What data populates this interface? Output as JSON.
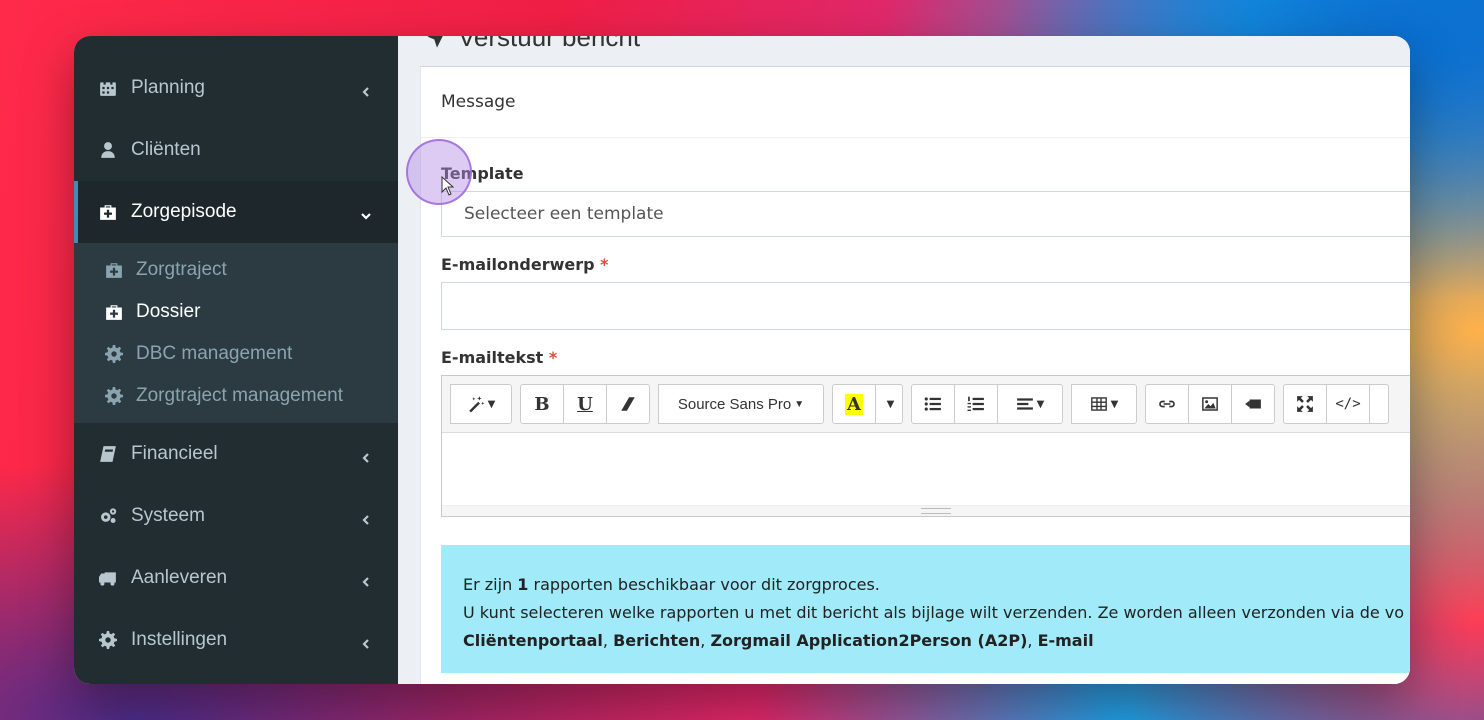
{
  "sidebar": {
    "items": [
      {
        "label": "Planning",
        "icon": "calendar-icon",
        "has_chevron": true
      },
      {
        "label": "Cliënten",
        "icon": "user-icon",
        "has_chevron": false
      },
      {
        "label": "Zorgepisode",
        "icon": "medkit-icon",
        "has_chevron": true,
        "active": true
      }
    ],
    "submenu": [
      {
        "label": "Zorgtraject",
        "icon": "medkit-icon"
      },
      {
        "label": "Dossier",
        "icon": "medkit-icon",
        "current": true
      },
      {
        "label": "DBC management",
        "icon": "gear-icon"
      },
      {
        "label": "Zorgtraject management",
        "icon": "gear-icon"
      }
    ],
    "items_after": [
      {
        "label": "Financieel",
        "icon": "book-icon"
      },
      {
        "label": "Systeem",
        "icon": "gears-icon"
      },
      {
        "label": "Aanleveren",
        "icon": "truck-icon"
      },
      {
        "label": "Instellingen",
        "icon": "gear-icon"
      }
    ]
  },
  "page": {
    "heading": "Verstuur bericht"
  },
  "form": {
    "box_title": "Message",
    "template_label": "Template",
    "template_value": "Selecteer een template",
    "subject_label": "E-mailonderwerp",
    "body_label": "E-mailtekst",
    "required_mark": "*"
  },
  "toolbar": {
    "font_name": "Source Sans Pro",
    "bold": "B",
    "underline": "U",
    "color_letter": "A",
    "code": "</>"
  },
  "callout": {
    "line1_pre": "Er zijn ",
    "line1_count": "1",
    "line1_post": " rapporten beschikbaar voor dit zorgproces.",
    "line2": "U kunt selecteren welke rapporten u met dit bericht als bijlage wilt verzenden. Ze worden alleen verzonden via de vo",
    "channels": [
      "Cliëntenportaal",
      "Berichten",
      "Zorgmail Application2Person (A2P)",
      "E-mail"
    ],
    "separator": ", "
  },
  "colors": {
    "sidebar_bg": "#222d32",
    "active_border": "#3c8dbc",
    "callout_bg": "#a0eaf9",
    "required": "#dd4b39"
  }
}
